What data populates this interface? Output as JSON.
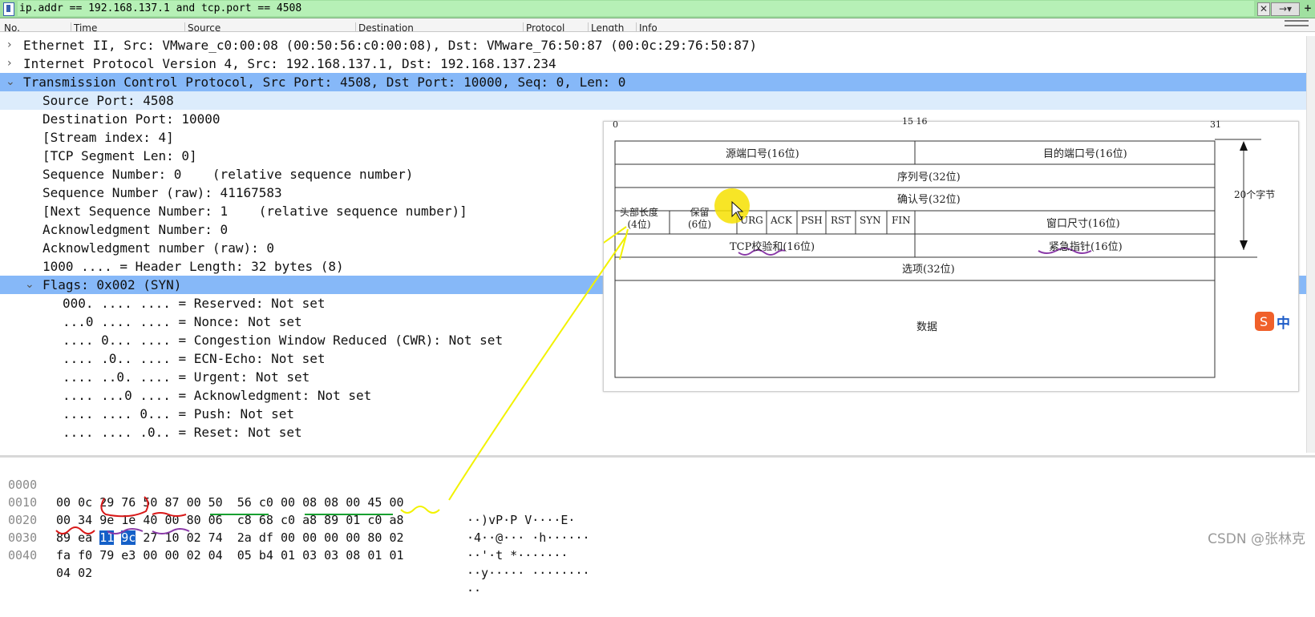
{
  "filter": {
    "value": "ip.addr == 192.168.137.1 and tcp.port == 4508"
  },
  "columns": [
    "No.",
    "Time",
    "Source",
    "Destination",
    "Protocol",
    "Length",
    "Info"
  ],
  "tree": [
    {
      "arrow": ">",
      "text": "Ethernet II, Src: VMware_c0:00:08 (00:50:56:c0:00:08), Dst: VMware_76:50:87 (00:0c:29:76:50:87)"
    },
    {
      "arrow": ">",
      "text": "Internet Protocol Version 4, Src: 192.168.137.1, Dst: 192.168.137.234"
    },
    {
      "arrow": "v",
      "text": "Transmission Control Protocol, Src Port: 4508, Dst Port: 10000, Seq: 0, Len: 0"
    },
    {
      "arrow": "",
      "text": "Source Port: 4508"
    },
    {
      "arrow": "",
      "text": "Destination Port: 10000"
    },
    {
      "arrow": "",
      "text": "[Stream index: 4]"
    },
    {
      "arrow": "",
      "text": "[TCP Segment Len: 0]"
    },
    {
      "arrow": "",
      "text": "Sequence Number: 0    (relative sequence number)"
    },
    {
      "arrow": "",
      "text": "Sequence Number (raw): 41167583"
    },
    {
      "arrow": "",
      "text": "[Next Sequence Number: 1    (relative sequence number)]"
    },
    {
      "arrow": "",
      "text": "Acknowledgment Number: 0"
    },
    {
      "arrow": "",
      "text": "Acknowledgment number (raw): 0"
    },
    {
      "arrow": "",
      "text": "1000 .... = Header Length: 32 bytes (8)"
    },
    {
      "arrow": "v",
      "text": "Flags: 0x002 (SYN)"
    },
    {
      "arrow": "",
      "text": "000. .... .... = Reserved: Not set"
    },
    {
      "arrow": "",
      "text": "...0 .... .... = Nonce: Not set"
    },
    {
      "arrow": "",
      "text": ".... 0... .... = Congestion Window Reduced (CWR): Not set"
    },
    {
      "arrow": "",
      "text": ".... .0.. .... = ECN-Echo: Not set"
    },
    {
      "arrow": "",
      "text": ".... ..0. .... = Urgent: Not set"
    },
    {
      "arrow": "",
      "text": ".... ...0 .... = Acknowledgment: Not set"
    },
    {
      "arrow": "",
      "text": ".... .... 0... = Push: Not set"
    },
    {
      "arrow": "",
      "text": ".... .... .0.. = Reset: Not set"
    }
  ],
  "hex": [
    {
      "offset": "0000",
      "bytes": [
        "00",
        "0c",
        "29",
        "76",
        "50",
        "87",
        "00",
        "50",
        "56",
        "c0",
        "00",
        "08",
        "08",
        "00",
        "45",
        "00"
      ],
      "ascii": "··)vP·P V····E·"
    },
    {
      "offset": "0010",
      "bytes": [
        "00",
        "34",
        "9e",
        "1e",
        "40",
        "00",
        "80",
        "06",
        "c8",
        "68",
        "c0",
        "a8",
        "89",
        "01",
        "c0",
        "a8"
      ],
      "ascii": "·4··@··· ·h······"
    },
    {
      "offset": "0020",
      "bytes": [
        "89",
        "ea",
        "11",
        "9c",
        "27",
        "10",
        "02",
        "74",
        "2a",
        "df",
        "00",
        "00",
        "00",
        "00",
        "80",
        "02"
      ],
      "ascii": "··'·t *·······"
    },
    {
      "offset": "0030",
      "bytes": [
        "fa",
        "f0",
        "79",
        "e3",
        "00",
        "00",
        "02",
        "04",
        "05",
        "b4",
        "01",
        "03",
        "03",
        "08",
        "01",
        "01"
      ],
      "ascii": "··y····· ········"
    },
    {
      "offset": "0040",
      "bytes": [
        "04",
        "02"
      ],
      "ascii": "··"
    }
  ],
  "diagram": {
    "bit_labels": {
      "start": "0",
      "mid": "15 16",
      "end": "31"
    },
    "src_port": "源端口号(16位)",
    "dst_port": "目的端口号(16位)",
    "seq": "序列号(32位)",
    "ack": "确认号(32位)",
    "header_len": "头部长度\n(4位)",
    "reserved": "保留\n(6位)",
    "flags": [
      "URG",
      "ACK",
      "PSH",
      "RST",
      "SYN",
      "FIN"
    ],
    "window": "窗口尺寸(16位)",
    "checksum": "TCP校验和(16位)",
    "urgent": "紧急指针(16位)",
    "options": "选项(32位)",
    "data": "数据",
    "size_label": "20个字节",
    "ime_label": "中"
  },
  "watermark": "CSDN @张林克",
  "colors": {
    "selected_row": "#86b8f8",
    "child_row": "#dcecfc",
    "hex_highlight": "#1560c8",
    "filter_bg": "#b6f0b6"
  }
}
